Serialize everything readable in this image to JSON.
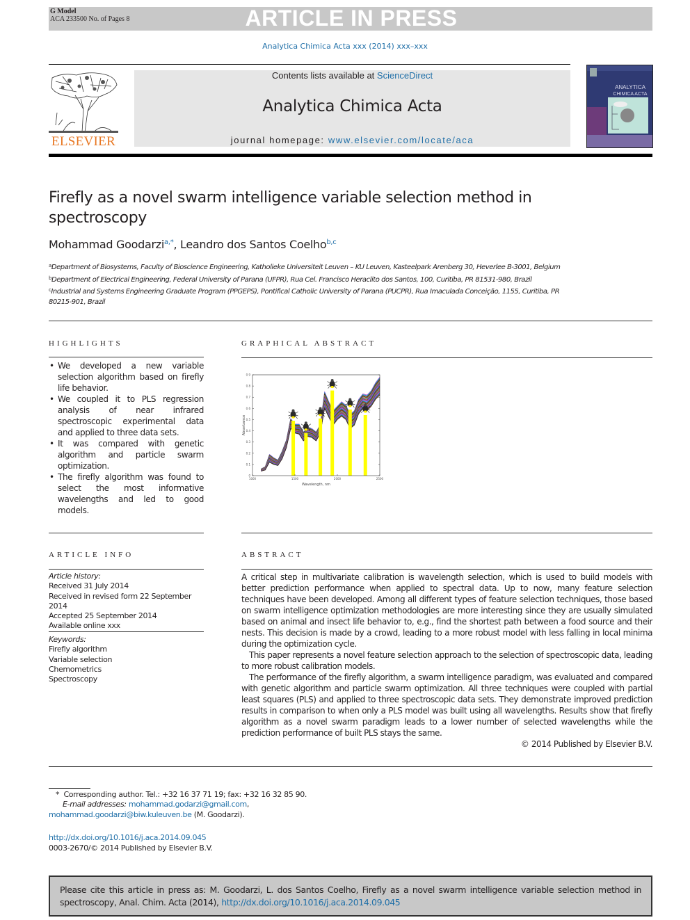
{
  "banner": {
    "model_label": "G Model",
    "manuscript_id": "ACA 233500 No. of Pages 8",
    "status_text": "ARTICLE IN PRESS"
  },
  "running_header": "Analytica Chimica Acta xxx (2014) xxx–xxx",
  "journal_header": {
    "publisher_logo_text": "ELSEVIER",
    "contents_prefix": "Contents lists available at ",
    "contents_link": "ScienceDirect",
    "journal_title": "Analytica Chimica Acta",
    "homepage_prefix": "journal homepage: ",
    "homepage_link": "www.elsevier.com/locate/aca",
    "cover_title_line1": "ANALYTICA",
    "cover_title_line2": "CHIMICA ACTA"
  },
  "article": {
    "title": "Firefly as a novel swarm intelligence variable selection method in spectroscopy",
    "authors": [
      {
        "name": "Mohammad Goodarzi",
        "sup": "a,*"
      },
      {
        "name": "Leandro dos Santos Coelho",
        "sup": "b,c"
      }
    ],
    "author_separator": ", ",
    "affiliations": [
      {
        "key": "a",
        "text": "Department of Biosystems, Faculty of Bioscience Engineering, Katholieke Universiteit Leuven – KU Leuven, Kasteelpark Arenberg 30, Heverlee B-3001, Belgium"
      },
      {
        "key": "b",
        "text": "Department of Electrical Engineering, Federal University of Parana (UFPR), Rua Cel. Francisco Heraclito dos Santos, 100, Curitiba, PR 81531-980, Brazil"
      },
      {
        "key": "c",
        "text": "Industrial and Systems Engineering Graduate Program (PPGEPS), Pontifical Catholic University of Parana (PUCPR), Rua Imaculada Conceição, 1155, Curitiba, PR 80215-901, Brazil"
      }
    ]
  },
  "highlights": {
    "heading": "HIGHLIGHTS",
    "items": [
      "We developed a new variable selection algorithm based on firefly life behavior.",
      "We coupled it to PLS regression analysis of near infrared spectroscopic experimental data and applied to three data sets.",
      "It was compared with genetic algorithm and particle swarm optimization.",
      "The firefly algorithm was found to select the most informative wavelengths and led to good models."
    ]
  },
  "graphical_abstract": {
    "heading": "GRAPHICAL ABSTRACT"
  },
  "chart_data": {
    "type": "line",
    "title": "",
    "xlabel": "Wavelength, nm",
    "ylabel": "Absorbance",
    "xlim": [
      1000,
      2500
    ],
    "ylim": [
      0,
      0.9
    ],
    "x_ticks": [
      "1000",
      "1500",
      "2000",
      "2500"
    ],
    "y_ticks": [
      "0",
      "0.1",
      "0.2",
      "0.3",
      "0.4",
      "0.5",
      "0.6",
      "0.7",
      "0.8",
      "0.9"
    ],
    "grid": false,
    "series_count_approx": 30,
    "spectrum_profile": {
      "x": [
        1100,
        1150,
        1200,
        1250,
        1300,
        1350,
        1400,
        1450,
        1500,
        1550,
        1600,
        1650,
        1700,
        1750,
        1800,
        1850,
        1900,
        1950,
        2000,
        2050,
        2100,
        2150,
        2200,
        2250,
        2300,
        2350,
        2400,
        2450,
        2500
      ],
      "y_low": [
        0.04,
        0.05,
        0.12,
        0.1,
        0.09,
        0.15,
        0.25,
        0.42,
        0.38,
        0.37,
        0.31,
        0.35,
        0.34,
        0.31,
        0.38,
        0.6,
        0.52,
        0.45,
        0.5,
        0.53,
        0.5,
        0.42,
        0.45,
        0.55,
        0.6,
        0.58,
        0.62,
        0.68,
        0.72
      ],
      "y_high": [
        0.06,
        0.08,
        0.19,
        0.16,
        0.14,
        0.22,
        0.32,
        0.51,
        0.46,
        0.46,
        0.39,
        0.43,
        0.42,
        0.39,
        0.46,
        0.75,
        0.66,
        0.58,
        0.62,
        0.66,
        0.63,
        0.55,
        0.58,
        0.68,
        0.73,
        0.72,
        0.76,
        0.83,
        0.88
      ]
    },
    "selected_wavelengths": [
      {
        "x": 1480,
        "y": 0.49
      },
      {
        "x": 1630,
        "y": 0.38
      },
      {
        "x": 1800,
        "y": 0.51
      },
      {
        "x": 1940,
        "y": 0.76
      },
      {
        "x": 2150,
        "y": 0.59
      },
      {
        "x": 2330,
        "y": 0.54
      }
    ],
    "marker_icon": "firefly-icon",
    "bar_color": "#ffff00"
  },
  "article_info": {
    "heading": "ARTICLE INFO",
    "history_label": "Article history:",
    "history": [
      "Received 31 July 2014",
      "Received in revised form 22 September 2014",
      "Accepted 25 September 2014",
      "Available online xxx"
    ],
    "keywords_label": "Keywords:",
    "keywords": [
      "Firefly algorithm",
      "Variable selection",
      "Chemometrics",
      "Spectroscopy"
    ]
  },
  "abstract": {
    "heading": "ABSTRACT",
    "paragraphs": [
      "A critical step in multivariate calibration is wavelength selection, which is used to build models with better prediction performance when applied to spectral data. Up to now, many feature selection techniques have been developed. Among all different types of feature selection techniques, those based on swarm intelligence optimization methodologies are more interesting since they are usually simulated based on animal and insect life behavior to, e.g., find the shortest path between a food source and their nests. This decision is made by a crowd, leading to a more robust model with less falling in local minima during the optimization cycle.",
      "This paper represents a novel feature selection approach to the selection of spectroscopic data, leading to more robust calibration models.",
      "The performance of the firefly algorithm, a swarm intelligence paradigm, was evaluated and compared with genetic algorithm and particle swarm optimization. All three techniques were coupled with partial least squares (PLS) and applied to three spectroscopic data sets. They demonstrate improved prediction results in comparison to when only a PLS model was built using all wavelengths. Results show that firefly algorithm as a novel swarm paradigm leads to a lower number of selected wavelengths while the prediction performance of built PLS stays the same."
    ],
    "copyright": "© 2014 Published by Elsevier B.V."
  },
  "footnote": {
    "marker": "*",
    "corresponding": "Corresponding author. Tel.: +32 16 37 71 19; fax: +32 16 32 85 90.",
    "email_label": "E-mail addresses:",
    "email1": "mohammad.godarzi@gmail.com",
    "email_sep": ",",
    "email2": "mohammad.goodarzi@biw.kuleuven.be",
    "email2_suffix": " (M. Goodarzi)."
  },
  "doi": {
    "link": "http://dx.doi.org/10.1016/j.aca.2014.09.045",
    "issn_line": "0003-2670/© 2014 Published by Elsevier B.V."
  },
  "cite_box": {
    "text": "Please cite this article in press as: M. Goodarzi, L. dos Santos Coelho, Firefly as a novel swarm intelligence variable selection method in spectroscopy, Anal. Chim. Acta (2014), ",
    "link": "http://dx.doi.org/10.1016/j.aca.2014.09.045"
  },
  "colors": {
    "link": "#1f6fa8",
    "elsevier_orange": "#e87722",
    "banner_gray": "#c8c8c8",
    "journal_box_gray": "#e6e6e6"
  }
}
